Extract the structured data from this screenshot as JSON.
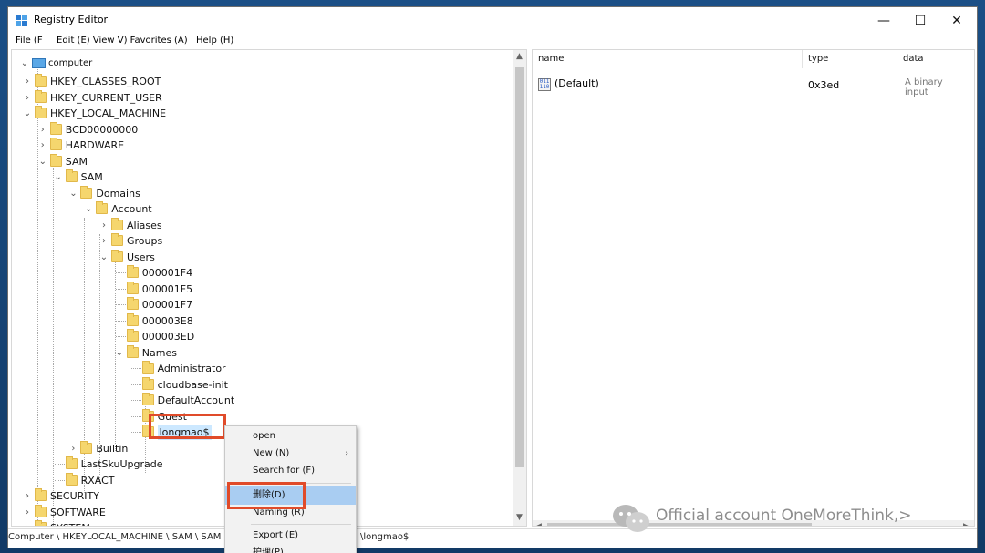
{
  "window": {
    "title": "Registry Editor",
    "minimize": "—",
    "maximize": "☐",
    "close": "✕"
  },
  "menu": [
    "File (F",
    "Edit (E) View V) Favorites (A)",
    "Help (H)"
  ],
  "tree": {
    "root": "computer",
    "nodes": [
      {
        "label": "HKEY_CLASSES_ROOT",
        "expander": "›"
      },
      {
        "label": "HKEY_CURRENT_USER",
        "expander": "›"
      },
      {
        "label": "HKEY_LOCAL_MACHINE",
        "expander": "⌄"
      },
      {
        "label": "BCD00000000",
        "expander": "›"
      },
      {
        "label": "HARDWARE",
        "expander": "›"
      },
      {
        "label": "SAM",
        "expander": "⌄"
      },
      {
        "label": "SAM",
        "expander": "⌄"
      },
      {
        "label": "Domains",
        "expander": "⌄"
      },
      {
        "label": "Account",
        "expander": "⌄"
      },
      {
        "label": "Aliases",
        "expander": "›"
      },
      {
        "label": "Groups",
        "expander": "›"
      },
      {
        "label": "Users",
        "expander": "⌄"
      },
      {
        "label": "000001F4",
        "expander": ""
      },
      {
        "label": "000001F5",
        "expander": ""
      },
      {
        "label": "000001F7",
        "expander": ""
      },
      {
        "label": "000003E8",
        "expander": ""
      },
      {
        "label": "000003ED",
        "expander": ""
      },
      {
        "label": "Names",
        "expander": "⌄"
      },
      {
        "label": "Administrator",
        "expander": ""
      },
      {
        "label": "cloudbase-init",
        "expander": ""
      },
      {
        "label": "DefaultAccount",
        "expander": ""
      },
      {
        "label": "Guest",
        "expander": ""
      },
      {
        "label": "longmao$",
        "expander": ""
      },
      {
        "label": "Builtin",
        "expander": "›"
      },
      {
        "label": "LastSkuUpgrade",
        "expander": ""
      },
      {
        "label": "RXACT",
        "expander": ""
      },
      {
        "label": "SECURITY",
        "expander": "›"
      },
      {
        "label": "SOFTWARE",
        "expander": "›"
      },
      {
        "label": "SYSTEM",
        "expander": "›"
      }
    ]
  },
  "list": {
    "columns": [
      "name",
      "type",
      "data"
    ],
    "rows": [
      {
        "name": "(Default)",
        "type": "0x3ed",
        "data": "A binary input"
      }
    ],
    "value_icon_text": "011 110"
  },
  "context_menu": {
    "items": [
      "open",
      "New (N)",
      "Search for (F)",
      "删除(D)",
      "Naming (R)",
      "Export (E)",
      "护理(P)"
    ],
    "submenu_arrow": "›"
  },
  "status": {
    "path": "Computer \\ HKEYLOCAL_MACHINE \\ SAM \\ SAM",
    "tail": "\\longmao$"
  },
  "watermark": {
    "text": "Official account OneMoreThink,>"
  }
}
